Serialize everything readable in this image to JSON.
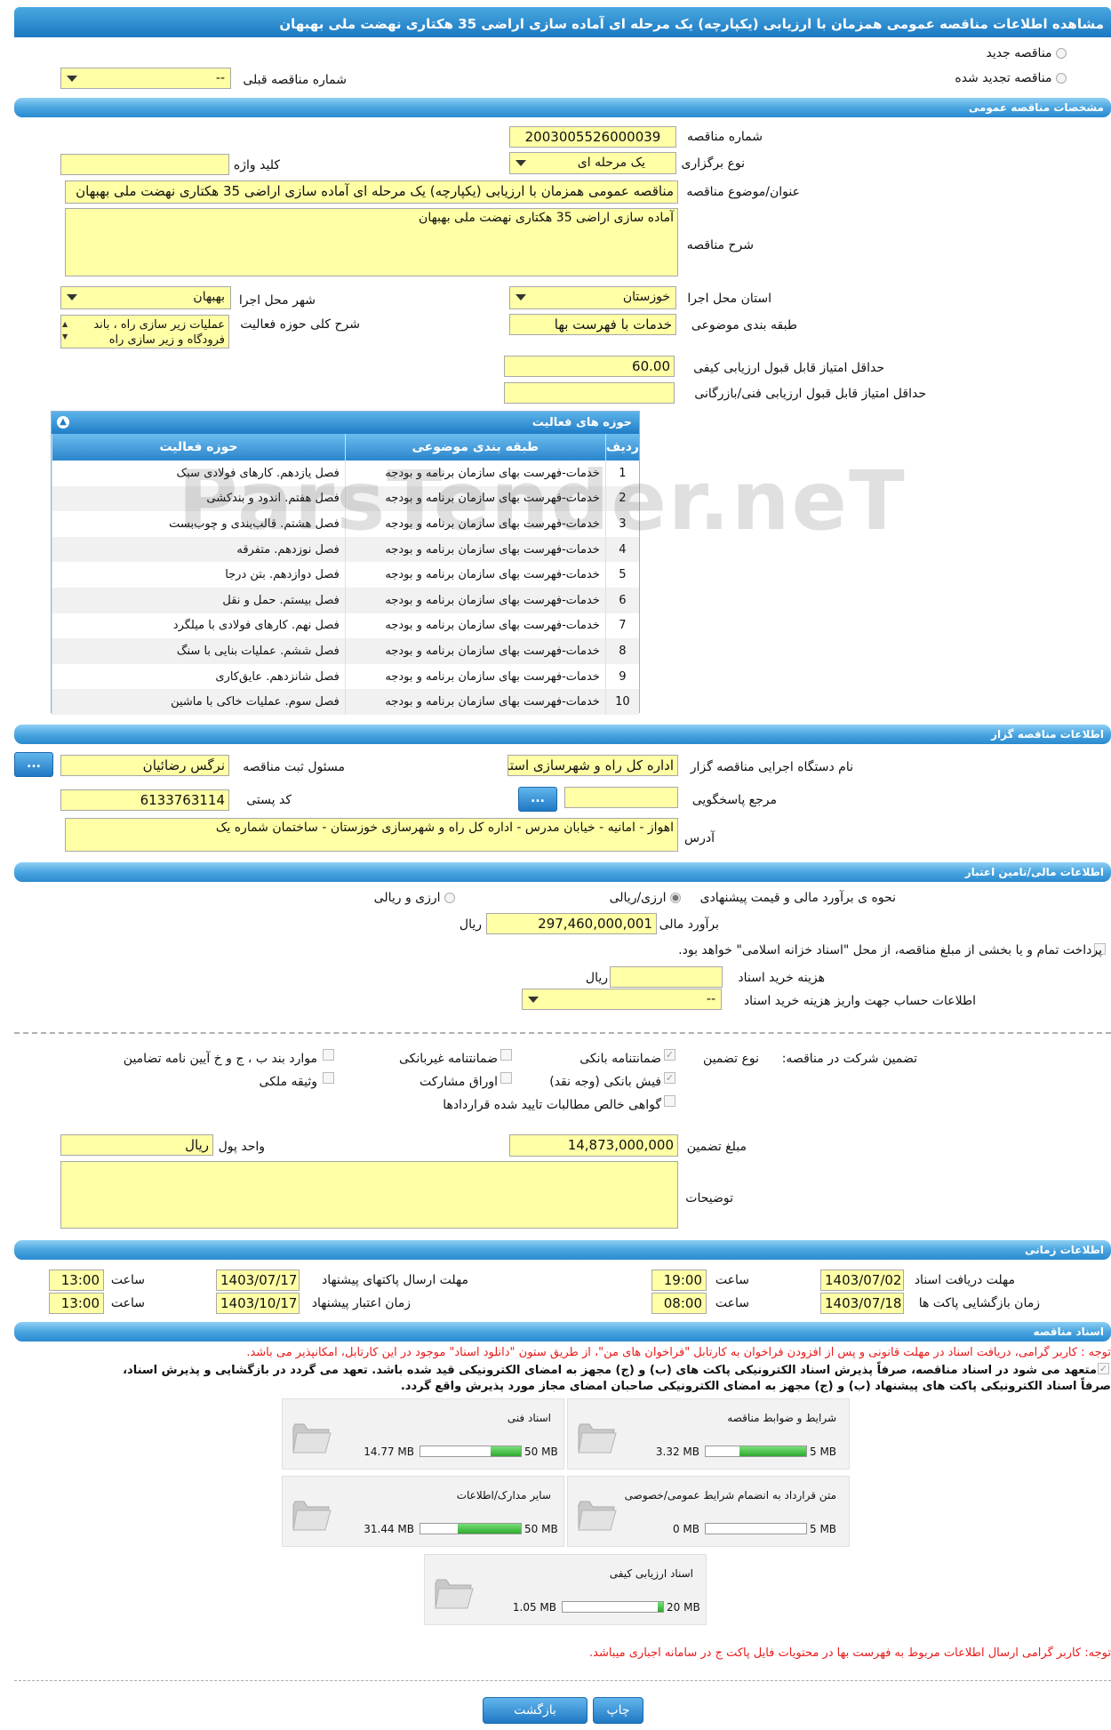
{
  "page_title": "مشاهده اطلاعات مناقصه عمومی همزمان با ارزیابی (یکپارچه) یک مرحله ای آماده سازی اراضی 35 هکتاری نهضت ملی بهبهان",
  "top": {
    "new_tender": "مناقصه جدید",
    "renewed_tender": "مناقصه تجدید شده",
    "prev_tender_label": "شماره مناقصه قبلی",
    "prev_tender_value": "--"
  },
  "general": {
    "header": "مشخصات مناقصه عمومی",
    "tender_no_label": "شماره مناقصه",
    "tender_no": "2003005526000039",
    "type_label": "نوع برگزاری",
    "type_value": "یک مرحله ای",
    "keyword_label": "کلید واژه",
    "keyword": "",
    "subject_label": "عنوان/موضوع مناقصه",
    "subject": "مناقصه عمومی همزمان با ارزیابی (یکپارچه) یک مرحله ای آماده سازی اراضی 35 هکتاری نهضت ملی بهبهان",
    "desc_label": "شرح مناقصه",
    "desc": "آماده سازی اراضی 35 هکتاری نهضت ملی بهبهان",
    "province_label": "استان محل اجرا",
    "province": "خوزستان",
    "city_label": "شهر محل اجرا",
    "city": "بهبهان",
    "category_label": "طبقه بندی موضوعی",
    "category": "خدمات با فهرست بها",
    "activity_label": "شرح کلی حوزه فعالیت",
    "activity": "عملیات زیر سازی راه ، باند فرودگاه و زیر سازی راه",
    "min_quality_label": "حداقل امتیاز قابل قبول ارزیابی کیفی",
    "min_quality": "60.00",
    "min_tech_label": "حداقل امتیاز قابل قبول ارزیابی فنی/بازرگانی",
    "min_tech": ""
  },
  "activities": {
    "title": "حوزه های فعالیت",
    "col_row": "ردیف",
    "col_category": "طبقه بندی موضوعی",
    "col_field": "حوزه فعالیت",
    "rows": [
      {
        "n": "1",
        "cat": "خدمات-فهرست بهای سازمان برنامه و بودجه",
        "field": "فصل یازدهم. کارهای فولادی سبک"
      },
      {
        "n": "2",
        "cat": "خدمات-فهرست بهای سازمان برنامه و بودجه",
        "field": "فصل هفتم. اندود و بندکشی"
      },
      {
        "n": "3",
        "cat": "خدمات-فهرست بهای سازمان برنامه و بودجه",
        "field": "فصل هشتم. قالب‌بندی و چوب‌بست"
      },
      {
        "n": "4",
        "cat": "خدمات-فهرست بهای سازمان برنامه و بودجه",
        "field": "فصل نوزدهم. متفرقه"
      },
      {
        "n": "5",
        "cat": "خدمات-فهرست بهای سازمان برنامه و بودجه",
        "field": "فصل دوازدهم. بتن درجا"
      },
      {
        "n": "6",
        "cat": "خدمات-فهرست بهای سازمان برنامه و بودجه",
        "field": "فصل بیستم. حمل و نقل"
      },
      {
        "n": "7",
        "cat": "خدمات-فهرست بهای سازمان برنامه و بودجه",
        "field": "فصل نهم. کارهای فولادی با میلگرد"
      },
      {
        "n": "8",
        "cat": "خدمات-فهرست بهای سازمان برنامه و بودجه",
        "field": "فصل ششم. عملیات بنایی با سنگ"
      },
      {
        "n": "9",
        "cat": "خدمات-فهرست بهای سازمان برنامه و بودجه",
        "field": "فصل شانزدهم. عایق‌کاری"
      },
      {
        "n": "10",
        "cat": "خدمات-فهرست بهای سازمان برنامه و بودجه",
        "field": "فصل سوم. عملیات خاکی با ماشین"
      }
    ]
  },
  "organizer": {
    "header": "اطلاعات مناقصه گزار",
    "org_label": "نام دستگاه اجرایی مناقصه گزار",
    "org": "اداره کل راه و شهرسازی استان خوزستان",
    "resp_label": "مسئول ثبت مناقصه",
    "resp": "نرگس رضائیان",
    "ref_label": "مرجع پاسخگویی",
    "ref": "",
    "postal_label": "کد پستی",
    "postal": "6133763114",
    "addr_label": "آدرس",
    "addr": "اهواز - امانیه - خیابان مدرس - اداره کل راه و شهرسازی خوزستان - ساختمان شماره یک",
    "btn": "..."
  },
  "financial": {
    "header": "اطلاعات مالی/تامین اعتبار",
    "method_label": "نحوه ی برآورد مالی و قیمت پیشنهادی",
    "opt1": "ارزی/ریالی",
    "opt2": "ارزی و ریالی",
    "estimate_label": "برآورد مالی",
    "estimate": "297,460,000,001",
    "rial": "ریال",
    "treasury": "پرداخت تمام و یا بخشی از مبلغ مناقصه، از محل \"اسناد خزانه اسلامی\" خواهد بود.",
    "doc_cost_label": "هزینه خرید اسناد",
    "doc_cost": "",
    "account_label": "اطلاعات حساب جهت واریز هزینه خرید اسناد",
    "account": "--"
  },
  "guarantee": {
    "label": "تضمین شرکت در مناقصه:",
    "type_label": "نوع تضمین",
    "bank": "ضمانتنامه بانکی",
    "nonbank": "ضمانتنامه غیربانکی",
    "clauses": "موارد بند ب ، ج و خ آیین نامه تضامین",
    "cash": "فیش بانکی (وجه نقد)",
    "bonds": "اوراق مشارکت",
    "property": "وثیقه ملکی",
    "claims": "گواهی خالص مطالبات تایید شده قراردادها",
    "amount_label": "مبلغ تضمین",
    "amount": "14,873,000,000",
    "unit_label": "واحد پول",
    "unit": "ریال",
    "notes_label": "توضیحات",
    "notes": ""
  },
  "timing": {
    "header": "اطلاعات زمانی",
    "doc_deadline_label": "مهلت دریافت اسناد",
    "doc_deadline": "1403/07/02",
    "time_label": "ساعت",
    "doc_time": "19:00",
    "send_deadline_label": "مهلت ارسال پاکتهای پیشنهاد",
    "send_deadline": "1403/07/17",
    "send_time": "13:00",
    "open_label": "زمان بازگشایی پاکت ها",
    "open_date": "1403/07/18",
    "open_time": "08:00",
    "valid_label": "زمان اعتبار پیشنهاد",
    "valid_date": "1403/10/17",
    "valid_time": "13:00"
  },
  "docs": {
    "header": "اسناد مناقصه",
    "note1": "توجه : کاربر گرامی، دریافت اسناد در مهلت قانونی و پس از افزودن فراخوان به کارتابل \"فراخوان های من\"، از طریق ستون \"دانلود اسناد\" موجود در این کارتابل، امکانپذیر می باشد.",
    "commit1": "متعهد می شود در اسناد مناقصه، صرفاً پذیرش اسناد الکترونیکی پاکت های (ب) و (ج) مجهز به امضای الکترونیکی قید شده باشد. تعهد می گردد در بازگشایی و پذیرش اسناد،",
    "commit2": "صرفاً اسناد الکترونیکی پاکت های پیشنهاد (ب) و (ج) مجهز به امضای الکترونیکی صاحبان امضای مجاز مورد پذیرش واقع گردد.",
    "files": [
      {
        "name": "شرایط و ضوابط مناقصه",
        "cur": "3.32 MB",
        "max": "5 MB",
        "fill": 0.66
      },
      {
        "name": "اسناد فنی",
        "cur": "14.77 MB",
        "max": "50 MB",
        "fill": 0.3
      },
      {
        "name": "متن قرارداد به انضمام شرایط عمومی/خصوصی",
        "cur": "0 MB",
        "max": "5 MB",
        "fill": 0.0
      },
      {
        "name": "سایر مدارک/اطلاعات",
        "cur": "31.44 MB",
        "max": "50 MB",
        "fill": 0.63
      },
      {
        "name": "اسناد ارزیابی کیفی",
        "cur": "1.05 MB",
        "max": "20 MB",
        "fill": 0.05
      }
    ],
    "note2": "توجه: کاربر گرامی ارسال اطلاعات مربوط به فهرست بها در محتویات فایل پاکت ج در سامانه اجباری میباشد."
  },
  "buttons": {
    "print": "چاپ",
    "back": "بازگشت"
  }
}
